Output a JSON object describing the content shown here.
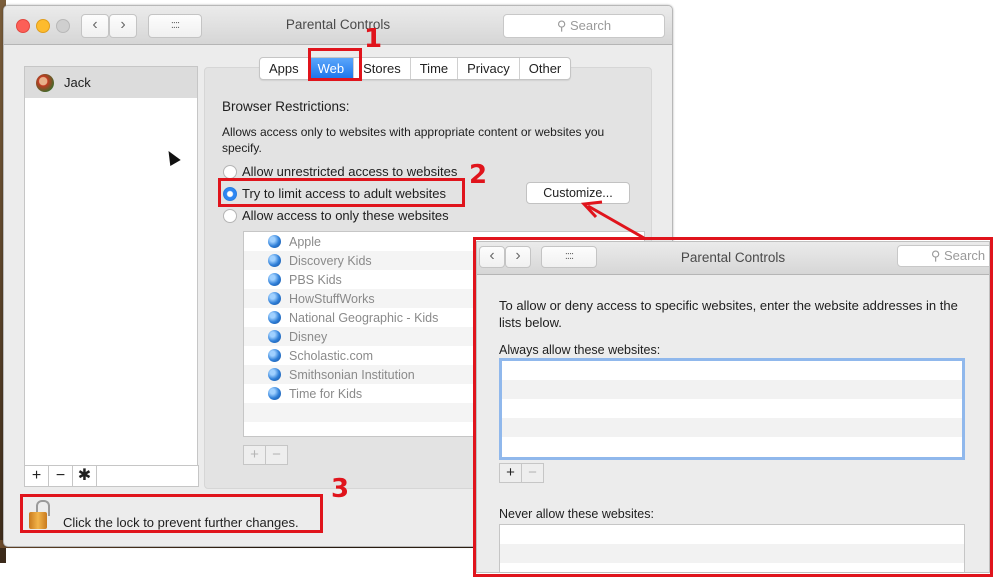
{
  "window": {
    "title": "Parental Controls",
    "search_placeholder": "Search",
    "back_glyph": "‹",
    "forward_glyph": "›",
    "grid_glyph": "::::"
  },
  "sidebar": {
    "users": [
      {
        "name": "Jack",
        "selected": true
      }
    ],
    "tools": {
      "add": "+",
      "remove": "−",
      "settings": "✱"
    }
  },
  "tabs": [
    {
      "label": "Apps",
      "active": false
    },
    {
      "label": "Web",
      "active": true
    },
    {
      "label": "Stores",
      "active": false
    },
    {
      "label": "Time",
      "active": false
    },
    {
      "label": "Privacy",
      "active": false
    },
    {
      "label": "Other",
      "active": false
    }
  ],
  "web": {
    "heading": "Browser Restrictions:",
    "description": "Allows access only to websites with appropriate content or websites you specify.",
    "options": [
      {
        "label": "Allow unrestricted access to websites",
        "checked": false
      },
      {
        "label": "Try to limit access to adult websites",
        "checked": true
      },
      {
        "label": "Allow access to only these websites",
        "checked": false
      }
    ],
    "customize_label": "Customize...",
    "sites": [
      "Apple",
      "Discovery Kids",
      "PBS Kids",
      "HowStuffWorks",
      "National Geographic - Kids",
      "Disney",
      "Scholastic.com",
      "Smithsonian Institution",
      "Time for Kids"
    ],
    "add": "+",
    "remove": "−"
  },
  "lock": {
    "text": "Click the lock to prevent further changes."
  },
  "annotations": {
    "step1": "1",
    "step2": "2",
    "step3": "3",
    "color": "#e0141c"
  },
  "customize_window": {
    "title": "Parental Controls",
    "search_placeholder": "Search",
    "description": "To allow or deny access to specific websites, enter the website addresses in the lists below.",
    "always_allow_label": "Always allow these websites:",
    "always_allow_sites": [],
    "never_allow_label": "Never allow these websites:",
    "never_allow_sites": [],
    "add": "+",
    "remove": "−"
  }
}
